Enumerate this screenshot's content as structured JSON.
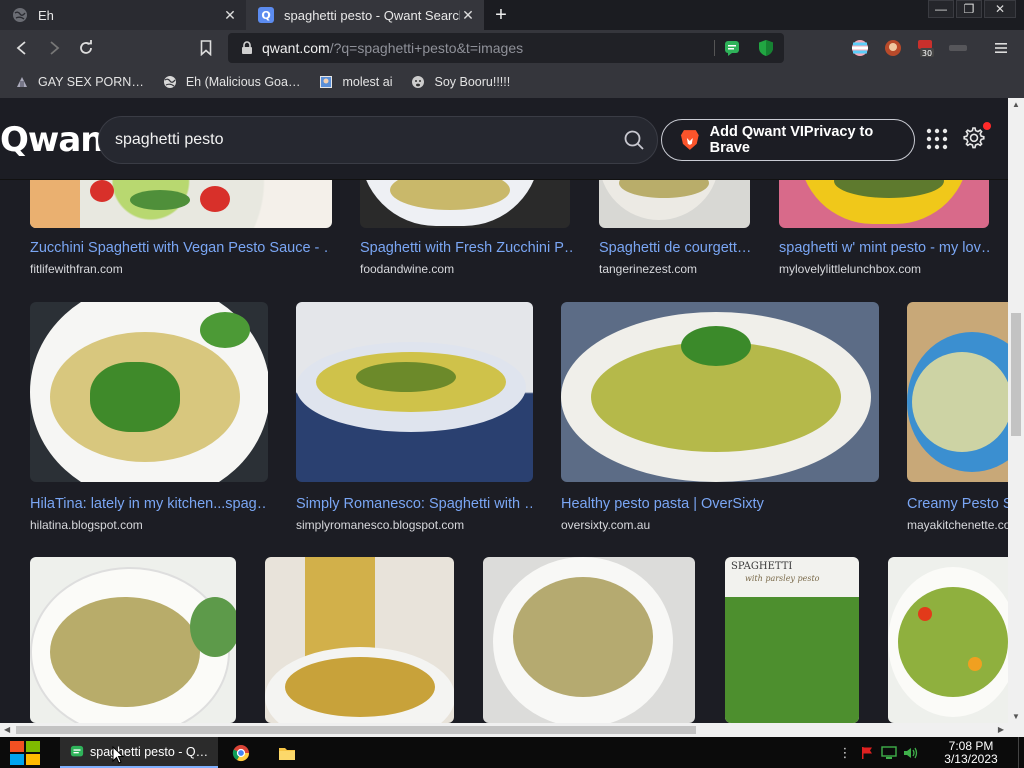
{
  "tabs": [
    {
      "title": "Eh",
      "active": false
    },
    {
      "title": "spaghetti pesto - Qwant Search",
      "active": true
    }
  ],
  "window_controls": {
    "minimize": "—",
    "maximize": "❐",
    "close": "✕"
  },
  "url": {
    "host": "qwant.com",
    "rest": "/?q=spaghetti+pesto&t=images"
  },
  "extensions": {
    "badge": "30"
  },
  "bookmarks": [
    {
      "label": "GAY SEX PORN…",
      "icon": "site-icon"
    },
    {
      "label": "Eh (Malicious Goa…",
      "icon": "globe-icon"
    },
    {
      "label": "molest ai",
      "icon": "image-icon"
    },
    {
      "label": "Soy Booru!!!!!",
      "icon": "soy-icon"
    }
  ],
  "qwant": {
    "logo": "Qwant",
    "query": "spaghetti pesto",
    "brave_cta": "Add Qwant VIPrivacy to Brave"
  },
  "results": [
    {
      "title": "Zucchini Spaghetti with Vegan Pesto Sauce - …",
      "source": "fitlifewithfran.com"
    },
    {
      "title": "Spaghetti with Fresh Zucchini P…",
      "source": "foodandwine.com"
    },
    {
      "title": "Spaghetti de courgett…",
      "source": "tangerinezest.com"
    },
    {
      "title": "spaghetti w' mint pesto - my lov…",
      "source": "mylovelylittlelunchbox.com"
    },
    {
      "title": "HilaTina: lately in my kitchen...spag…",
      "source": "hilatina.blogspot.com"
    },
    {
      "title": "Simply Romanesco: Spaghetti with …",
      "source": "simplyromanesco.blogspot.com"
    },
    {
      "title": "Healthy pesto pasta | OverSixty",
      "source": "oversixty.com.au"
    },
    {
      "title": "Creamy Pesto S…",
      "source": "mayakitchenette.co…"
    },
    {
      "overlay": "SPAGHETTI",
      "overlay_sub": "with parsley pesto"
    }
  ],
  "taskbar": {
    "active_task": "spaghetti pesto - Q…",
    "time": "7:08 PM",
    "date": "3/13/2023"
  },
  "colors": {
    "accent_link": "#7aa6f4",
    "page_bg": "#1c1d24",
    "notif": "#ff2a2a"
  }
}
